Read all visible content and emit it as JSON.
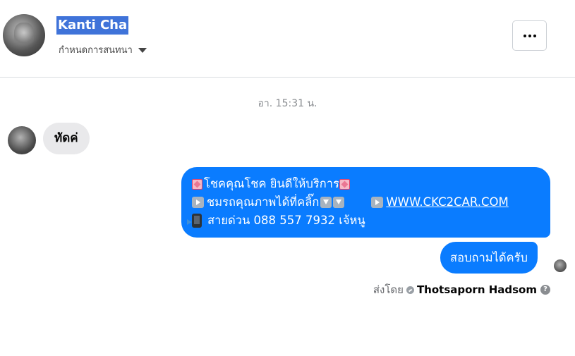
{
  "header": {
    "contact_name": "Kanti Cha",
    "settings_label": "กำหนดการสนทนา",
    "more_button_icon": "ellipsis-icon"
  },
  "conversation": {
    "timestamp": "อา. 15:31 น.",
    "incoming": {
      "text": "ทัดค่"
    },
    "outgoing": [
      {
        "line1": "โชคคุณโชค ยินดีให้บริการ",
        "line2": "ชมรถคุณภาพได้ที่คลิ๊ก",
        "link": "WWW.CKC2CAR.COM",
        "line3": "สายด่วน 088 557 7932 เจ้หนู"
      },
      {
        "text": "สอบถามได้ครับ"
      }
    ],
    "sent_by": {
      "label": "ส่งโดย",
      "name": "Thotsaporn Hadsom"
    }
  },
  "colors": {
    "outgoing_bubble": "#0a7cff",
    "incoming_bubble": "#e9e9eb",
    "name_highlight": "#3f73d9"
  }
}
